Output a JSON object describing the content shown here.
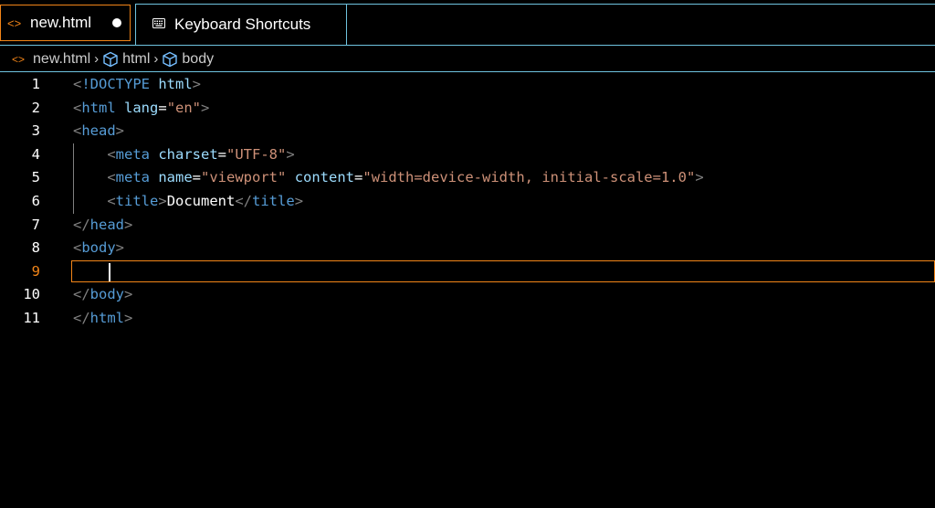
{
  "tabs": [
    {
      "label": "new.html",
      "icon": "code-icon",
      "active": true,
      "dirty": true
    },
    {
      "label": "Keyboard Shortcuts",
      "icon": "keyboard-icon",
      "active": false
    }
  ],
  "breadcrumb": [
    {
      "label": "new.html",
      "icon": "code-icon"
    },
    {
      "label": "html",
      "icon": "cube-icon"
    },
    {
      "label": "body",
      "icon": "cube-icon"
    }
  ],
  "editor": {
    "current_line": 9,
    "line_numbers": [
      "1",
      "2",
      "3",
      "4",
      "5",
      "6",
      "7",
      "8",
      "9",
      "10",
      "11"
    ],
    "lines": [
      {
        "tokens": [
          [
            "br",
            "<"
          ],
          [
            "tag",
            "!DOCTYPE"
          ],
          [
            "text",
            " "
          ],
          [
            "attr",
            "html"
          ],
          [
            "br",
            ">"
          ]
        ]
      },
      {
        "tokens": [
          [
            "br",
            "<"
          ],
          [
            "tag",
            "html"
          ],
          [
            "text",
            " "
          ],
          [
            "attr",
            "lang"
          ],
          [
            "eq",
            "="
          ],
          [
            "str",
            "\"en\""
          ],
          [
            "br",
            ">"
          ]
        ]
      },
      {
        "tokens": [
          [
            "br",
            "<"
          ],
          [
            "tag",
            "head"
          ],
          [
            "br",
            ">"
          ]
        ]
      },
      {
        "tokens": [
          [
            "text",
            "    "
          ],
          [
            "br",
            "<"
          ],
          [
            "tag",
            "meta"
          ],
          [
            "text",
            " "
          ],
          [
            "attr",
            "charset"
          ],
          [
            "eq",
            "="
          ],
          [
            "str",
            "\"UTF-8\""
          ],
          [
            "br",
            ">"
          ]
        ]
      },
      {
        "tokens": [
          [
            "text",
            "    "
          ],
          [
            "br",
            "<"
          ],
          [
            "tag",
            "meta"
          ],
          [
            "text",
            " "
          ],
          [
            "attr",
            "name"
          ],
          [
            "eq",
            "="
          ],
          [
            "str",
            "\"viewport\""
          ],
          [
            "text",
            " "
          ],
          [
            "attr",
            "content"
          ],
          [
            "eq",
            "="
          ],
          [
            "str",
            "\"width=device-width, initial-scale=1.0\""
          ],
          [
            "br",
            ">"
          ]
        ]
      },
      {
        "tokens": [
          [
            "text",
            "    "
          ],
          [
            "br",
            "<"
          ],
          [
            "tag",
            "title"
          ],
          [
            "br",
            ">"
          ],
          [
            "text",
            "Document"
          ],
          [
            "br",
            "</"
          ],
          [
            "tag",
            "title"
          ],
          [
            "br",
            ">"
          ]
        ]
      },
      {
        "tokens": [
          [
            "br",
            "</"
          ],
          [
            "tag",
            "head"
          ],
          [
            "br",
            ">"
          ]
        ]
      },
      {
        "tokens": [
          [
            "br",
            "<"
          ],
          [
            "tag",
            "body"
          ],
          [
            "br",
            ">"
          ]
        ]
      },
      {
        "tokens": [
          [
            "text",
            "    "
          ]
        ]
      },
      {
        "tokens": [
          [
            "br",
            "</"
          ],
          [
            "tag",
            "body"
          ],
          [
            "br",
            ">"
          ]
        ]
      },
      {
        "tokens": [
          [
            "br",
            "</"
          ],
          [
            "tag",
            "html"
          ],
          [
            "br",
            ">"
          ]
        ]
      }
    ]
  },
  "colors": {
    "accent": "#f38518",
    "border": "#6fc3df",
    "tag": "#569cd6",
    "attr": "#9cdcfe",
    "string": "#ce9178",
    "bracket": "#808080"
  }
}
